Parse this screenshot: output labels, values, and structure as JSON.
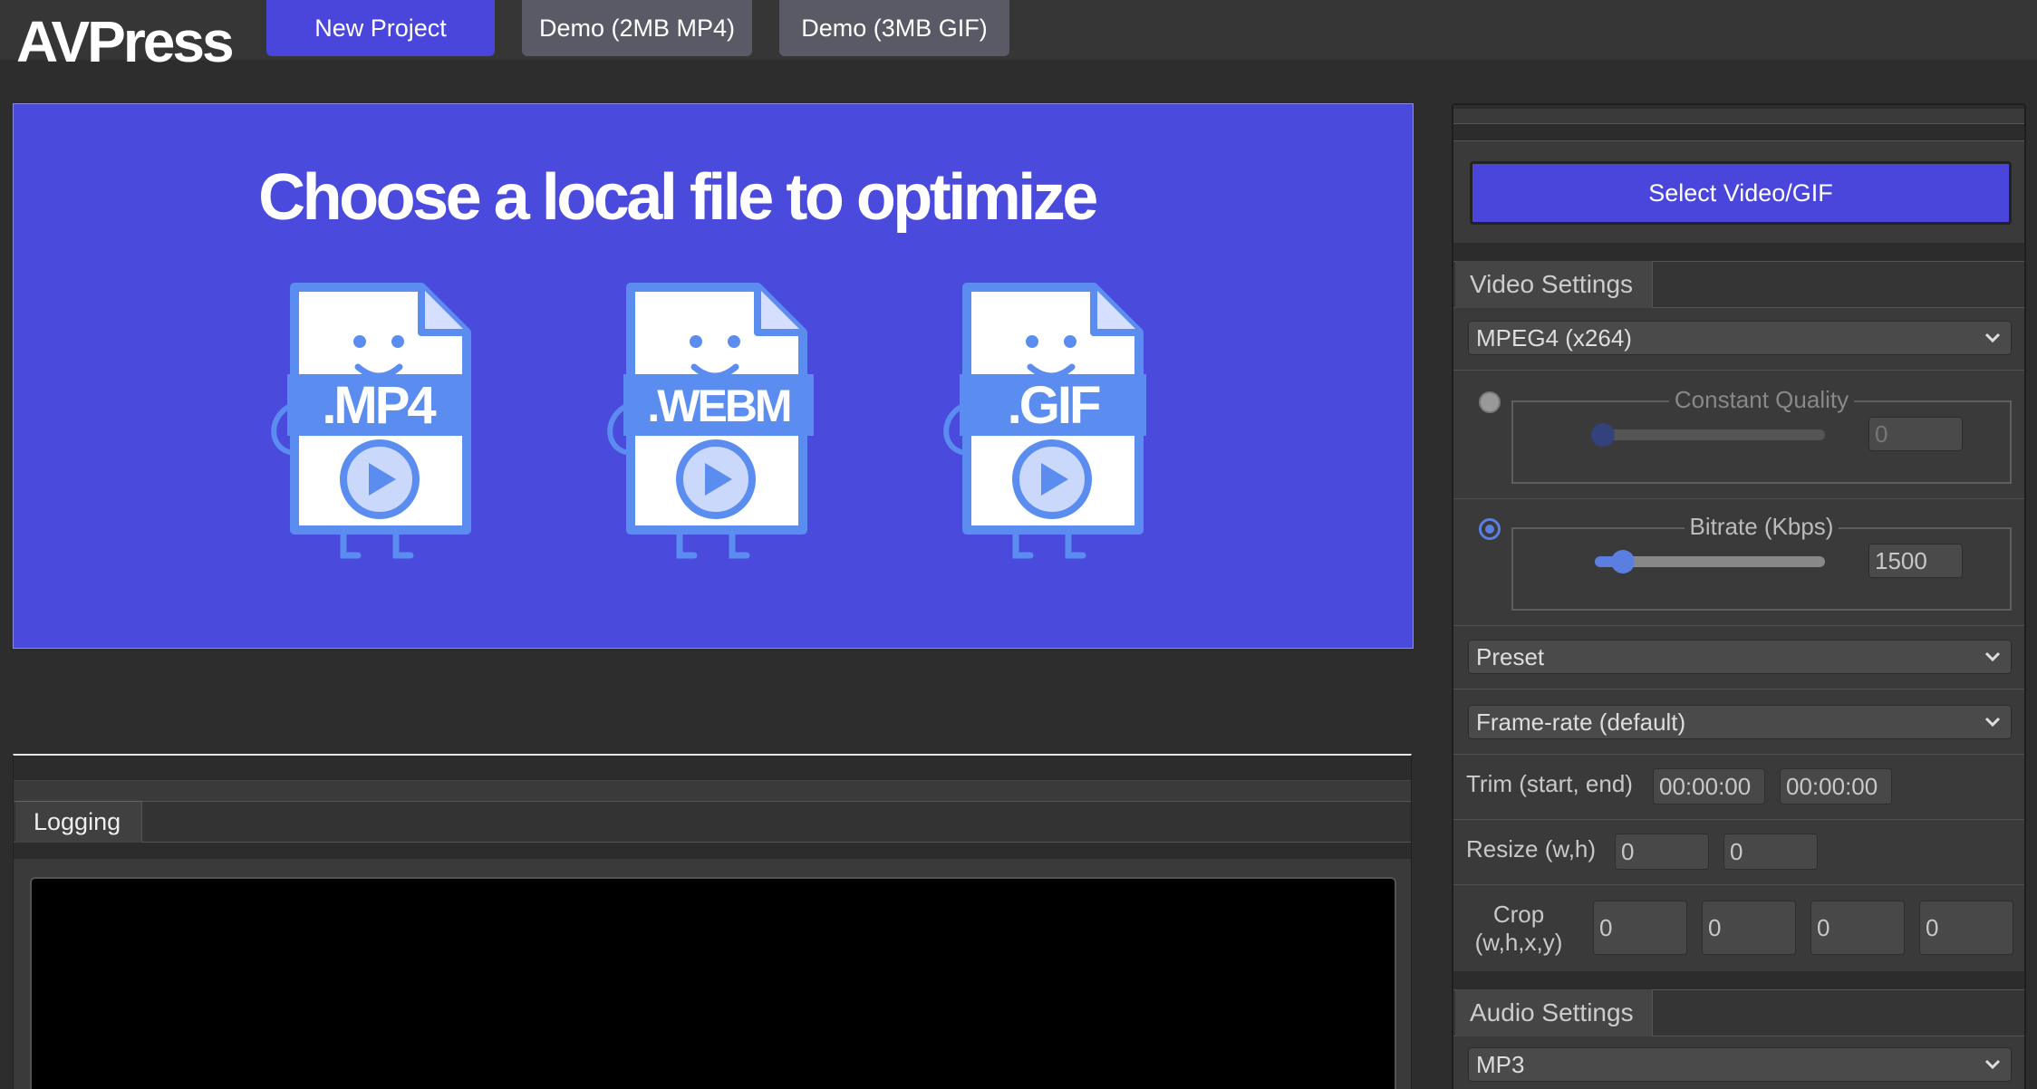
{
  "app": {
    "logo": "AVPress"
  },
  "nav": {
    "new_project": "New Project",
    "demo_mp4": "Demo (2MB MP4)",
    "demo_gif": "Demo (3MB GIF)"
  },
  "dropzone": {
    "title": "Choose a local file to optimize",
    "files": [
      {
        "ext": ".MP4"
      },
      {
        "ext": ".WEBM"
      },
      {
        "ext": ".GIF"
      }
    ]
  },
  "log": {
    "tab_label": "Logging",
    "content": ""
  },
  "settings": {
    "select_button": "Select Video/GIF",
    "video_tab": "Video Settings",
    "codec": "MPEG4 (x264)",
    "constant_quality": {
      "label": "Constant Quality",
      "value": "0",
      "selected": false
    },
    "bitrate": {
      "label": "Bitrate (Kbps)",
      "value": "1500",
      "selected": true
    },
    "preset": "Preset",
    "framerate": "Frame-rate (default)",
    "trim": {
      "label": "Trim (start, end)",
      "start": "00:00:00",
      "end": "00:00:00"
    },
    "resize": {
      "label": "Resize (w,h)",
      "w": "0",
      "h": "0"
    },
    "crop": {
      "label_line1": "Crop",
      "label_line2": "(w,h,x,y)",
      "w": "0",
      "h": "0",
      "x": "0",
      "y": "0"
    },
    "audio_tab": "Audio Settings",
    "audio_codec": "MP3"
  },
  "colors": {
    "accent": "#4a46dc",
    "file_blue": "#5b8cf0",
    "background": "#2d2d2d",
    "panel": "#3a3a3a"
  }
}
